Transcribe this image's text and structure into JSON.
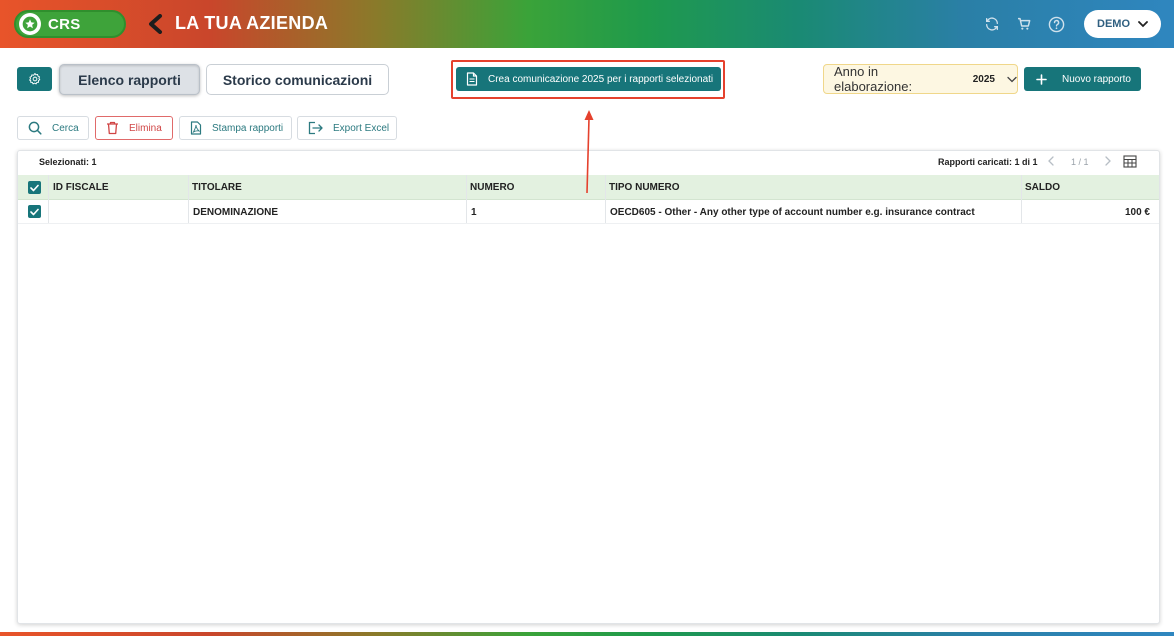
{
  "header": {
    "app_name": "CRS",
    "company_title": "LA TUA AZIENDA",
    "user_menu_label": "DEMO"
  },
  "tabs": [
    {
      "label": "Elenco rapporti",
      "active": true
    },
    {
      "label": "Storico comunicazioni",
      "active": false
    }
  ],
  "toolbar": {
    "create_communication_label": "Crea comunicazione 2025 per i rapporti selezionati",
    "year_label": "Anno in elaborazione:",
    "year_value": "2025",
    "new_report_label": "Nuovo rapporto"
  },
  "actions": {
    "search_label": "Cerca",
    "delete_label": "Elimina",
    "print_label": "Stampa rapporti",
    "export_label": "Export Excel"
  },
  "grid": {
    "selected_text": "Selezionati: 1",
    "loaded_text": "Rapporti caricati: 1 di 1",
    "pages_text": "1 / 1",
    "columns": [
      "ID FISCALE",
      "TITOLARE",
      "NUMERO",
      "TIPO NUMERO",
      "SALDO"
    ],
    "rows": [
      {
        "selected": true,
        "id_fiscale": "",
        "titolare": "DENOMINAZIONE",
        "numero": "1",
        "tipo_numero": "OECD605 - Other - Any other type of account number e.g. insurance contract",
        "saldo": "100 €"
      }
    ]
  },
  "colors": {
    "primary": "#17757a",
    "annotation_red": "#e5412d",
    "header_green": "#3ea33a",
    "table_header_bg": "#e3f1e0"
  },
  "icons": {
    "app": "star-icon",
    "back": "chevron-left-icon",
    "refresh": "refresh-icon",
    "cart": "cart-icon",
    "help": "help-icon",
    "settings": "gear-icon",
    "document": "document-icon",
    "add": "plus-icon",
    "search": "search-icon",
    "delete": "trash-icon",
    "print": "pdf-icon",
    "export": "export-icon",
    "columns": "table-icon"
  }
}
